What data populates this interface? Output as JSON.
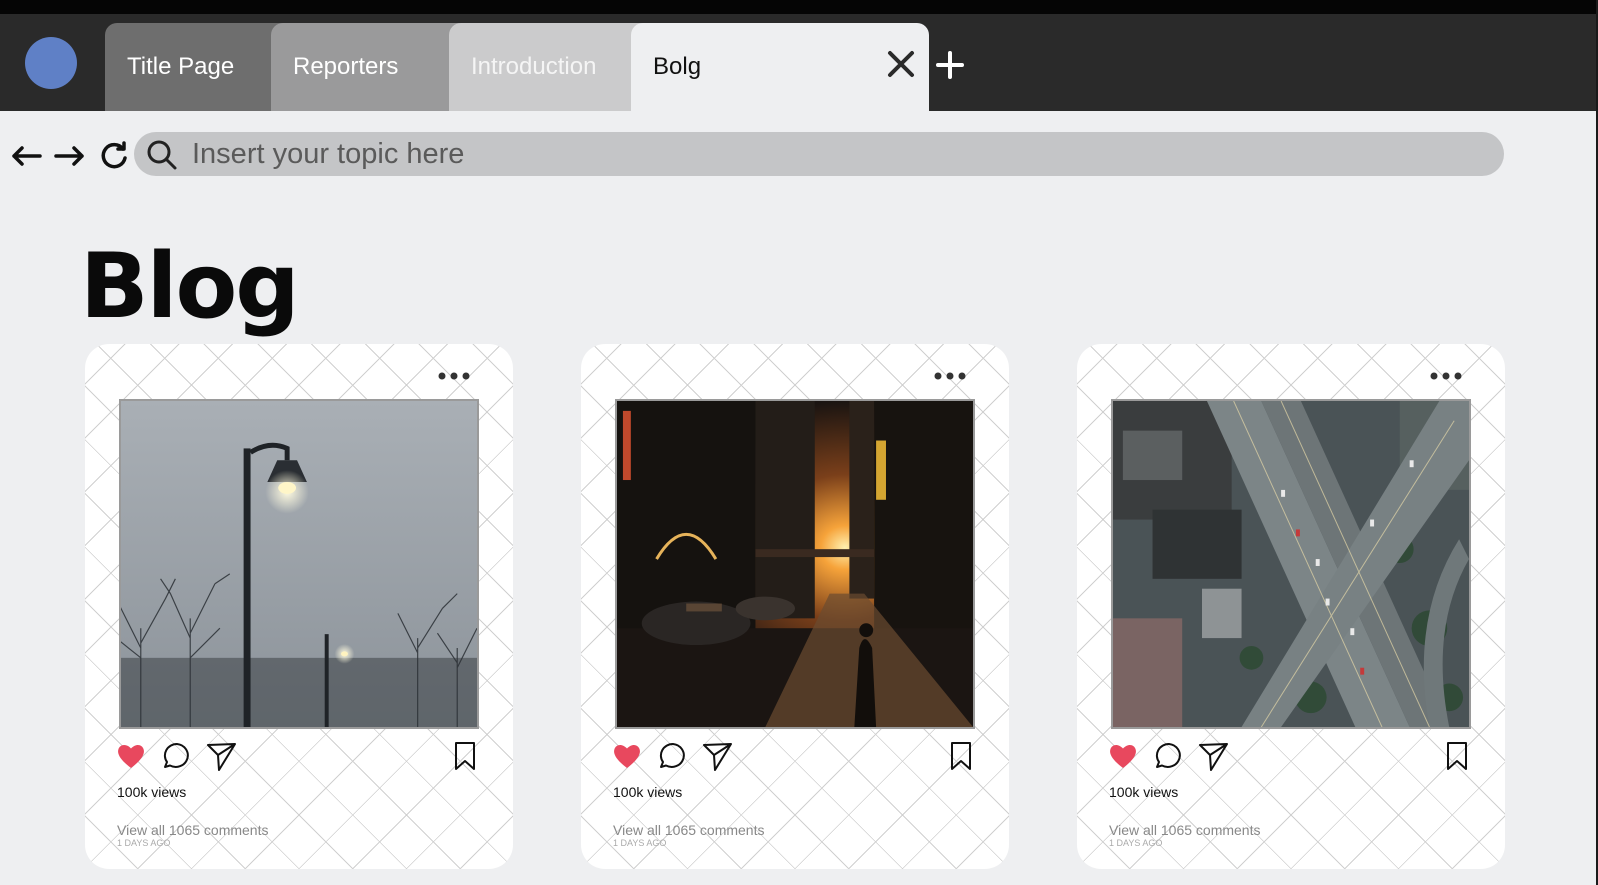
{
  "tabs": [
    {
      "label": "Title Page"
    },
    {
      "label": "Reporters"
    },
    {
      "label": "Introduction"
    },
    {
      "label": "Bolg"
    }
  ],
  "search": {
    "placeholder": "Insert your topic here"
  },
  "page": {
    "title": "Blog"
  },
  "posts": [
    {
      "views": "100k views",
      "comments": "View all 1065 comments",
      "ago": "1 DAYS AGO",
      "photo": "foggy street lamp and bare trees"
    },
    {
      "views": "100k views",
      "comments": "View all 1065 comments",
      "ago": "1 DAYS AGO",
      "photo": "city street at sunset"
    },
    {
      "views": "100k views",
      "comments": "View all 1065 comments",
      "ago": "1 DAYS AGO",
      "photo": "aerial view of highway interchange"
    }
  ],
  "icons": {
    "close": "close-icon",
    "add": "plus-icon",
    "back": "arrow-left-icon",
    "forward": "arrow-right-icon",
    "refresh": "refresh-icon",
    "search": "search-icon",
    "more": "more-dots-icon",
    "like": "heart-icon",
    "comment": "comment-icon",
    "share": "send-icon",
    "save": "bookmark-icon"
  },
  "colors": {
    "avatar": "#5f80c6",
    "like": "#e8485e",
    "topbar": "#2a2a2a",
    "page_bg": "#eeeff1"
  }
}
